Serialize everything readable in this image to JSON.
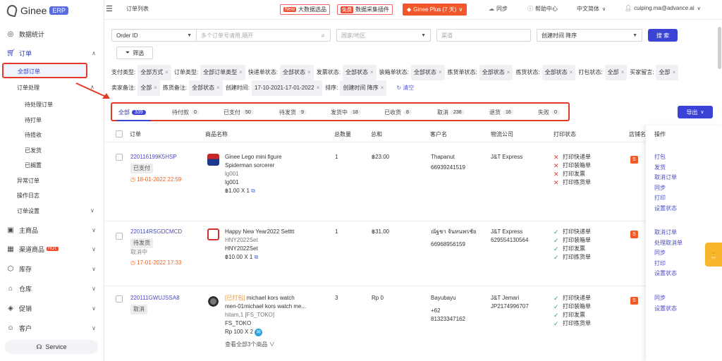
{
  "brand": {
    "name": "Ginee",
    "badge": "ERP"
  },
  "sidebar": {
    "items": [
      {
        "label": "数据统计",
        "icon": "dashboard-icon"
      },
      {
        "label": "订单",
        "icon": "cart-icon"
      },
      {
        "label": "主商品",
        "icon": "box-icon"
      },
      {
        "label": "渠道商品",
        "icon": "grid-icon",
        "hot": "HOT"
      },
      {
        "label": "库存",
        "icon": "cube-icon"
      },
      {
        "label": "仓库",
        "icon": "warehouse-icon"
      },
      {
        "label": "促销",
        "icon": "tag-icon"
      },
      {
        "label": "客户",
        "icon": "users-icon"
      }
    ],
    "order_sub": [
      "全部订单",
      "订单处理",
      "异常订单",
      "操作日志",
      "订单设置"
    ],
    "processing_sub": [
      "待处理订单",
      "待打单",
      "待揽收",
      "已发货",
      "已搁置"
    ],
    "service": "Service"
  },
  "header": {
    "page_title": "订单列表",
    "bigdata": {
      "tag": "New",
      "label": "大数据选品"
    },
    "plugin": {
      "tag": "免费",
      "label": "数据采集插件"
    },
    "plan": "Ginee Plus (7 天)",
    "sync": "同步",
    "help": "帮助中心",
    "lang": "中文简体",
    "user": "cuiping.ma@advance.ai"
  },
  "filters": {
    "search_type": "Order ID",
    "search_placeholder": "多个订单号请用,隔开",
    "country_placeholder": "国家/地区",
    "channel_placeholder": "渠道",
    "sort": "创建时间 降序",
    "search_button": "搜 索",
    "filter_button": "筛选",
    "chips": [
      {
        "label": "支付类型:",
        "value": "全部方式"
      },
      {
        "label": "订单类型:",
        "value": "全部订单类型"
      },
      {
        "label": "快递单状态:",
        "value": "全部状态"
      },
      {
        "label": "发票状态:",
        "value": "全部状态"
      },
      {
        "label": "装箱单状态:",
        "value": "全部状态"
      },
      {
        "label": "拣货单状态:",
        "value": "全部状态"
      },
      {
        "label": "拣货状态:",
        "value": "全部状态"
      },
      {
        "label": "打包状态:",
        "value": "全部"
      },
      {
        "label": "买家留言:",
        "value": "全部"
      },
      {
        "label": "卖家备注:",
        "value": "全部"
      },
      {
        "label": "拣货备注:",
        "value": "全部状态"
      },
      {
        "label": "创建时间:",
        "value": "17-10-2021-17-01-2022"
      },
      {
        "label": "排序:",
        "value": "创建时间 降序"
      }
    ],
    "clear": "清空"
  },
  "tabs": [
    {
      "label": "全部",
      "count": "339"
    },
    {
      "label": "待付款",
      "count": "0"
    },
    {
      "label": "已支付",
      "count": "50"
    },
    {
      "label": "待发货",
      "count": "9"
    },
    {
      "label": "发货中",
      "count": "18"
    },
    {
      "label": "已收货",
      "count": "8"
    },
    {
      "label": "取消",
      "count": "238"
    },
    {
      "label": "退货",
      "count": "16"
    },
    {
      "label": "失败",
      "count": "0"
    }
  ],
  "export_button": "导出",
  "columns": [
    "订单",
    "商品名称",
    "总数量",
    "总和",
    "客户名",
    "物流公司",
    "打印状态",
    "店铺名",
    "操作"
  ],
  "orders": [
    {
      "id": "220116199K5HSP",
      "status": "已支付",
      "time": "18-01-2022 22:59",
      "product": {
        "name1": "Ginee Lego mini figure",
        "name2": "Spiderman sorcerer",
        "sku": "lg001",
        "variant": "lg001",
        "price": "฿1.00 X 1"
      },
      "qty": "1",
      "total": "฿23.00",
      "customer": {
        "name": "Thapanut",
        "phone": "66939241519"
      },
      "logistics": {
        "company": "J&T Express",
        "tracking": ""
      },
      "print": [
        {
          "ok": false,
          "label": "打印快递单"
        },
        {
          "ok": false,
          "label": "打印装箱单"
        },
        {
          "ok": false,
          "label": "打印发票"
        },
        {
          "ok": false,
          "label": "打印拣货单"
        }
      ],
      "actions": [
        "打包",
        "发货",
        "取消订单",
        "同步",
        "打印",
        "设置状态"
      ]
    },
    {
      "id": "220114RSGDCMCD",
      "status": "待发货",
      "sub_status": "取消中",
      "time": "17-01-2022 17:33",
      "product": {
        "name1": "Happy New Year2022 Setttt",
        "name2": "",
        "sku": "HNY2022Set",
        "variant": "HNY2022Set",
        "price": "฿10.00 X 1"
      },
      "qty": "1",
      "total": "฿31.00",
      "customer": {
        "name": "ณัฐชา จันทนพรชัย",
        "phone": "66968956159"
      },
      "logistics": {
        "company": "J&T Express",
        "tracking": "629554130564"
      },
      "print": [
        {
          "ok": true,
          "label": "打印快递单"
        },
        {
          "ok": true,
          "label": "打印装箱单"
        },
        {
          "ok": true,
          "label": "打印发票"
        },
        {
          "ok": true,
          "label": "打印拣货单"
        }
      ],
      "actions": [
        "取消订单",
        "处理取消单",
        "同步",
        "打印",
        "设置状态"
      ]
    },
    {
      "id": "220111GWUJSSA8",
      "status": "取消",
      "product": {
        "prefix": "[已打包]",
        "name1": "michael kors watch",
        "name2": "men-01michael kors watch me...",
        "sku": "hitam,1 [FS_TOKO]",
        "variant": "FS_TOKO",
        "price": "Rp 100 X 2"
      },
      "qty": "3",
      "total": "Rp 0",
      "customer": {
        "name": "Bayubayu",
        "phone1": "+62",
        "phone2": "81323347162"
      },
      "logistics": {
        "company": "J&T Jemari",
        "tracking": "JP2174996707"
      },
      "print": [
        {
          "ok": true,
          "label": "打印快递单"
        },
        {
          "ok": true,
          "label": "打印装箱单"
        },
        {
          "ok": true,
          "label": "打印发票"
        },
        {
          "ok": true,
          "label": "打印拣货单"
        }
      ],
      "more": "查看全部3个商品",
      "actions": [
        "同步",
        "设置状态"
      ]
    }
  ],
  "colors": {
    "primary": "#3b43d6",
    "highlight": "#e33b2a",
    "warning": "#f0621e",
    "plan": "#f2572c"
  }
}
